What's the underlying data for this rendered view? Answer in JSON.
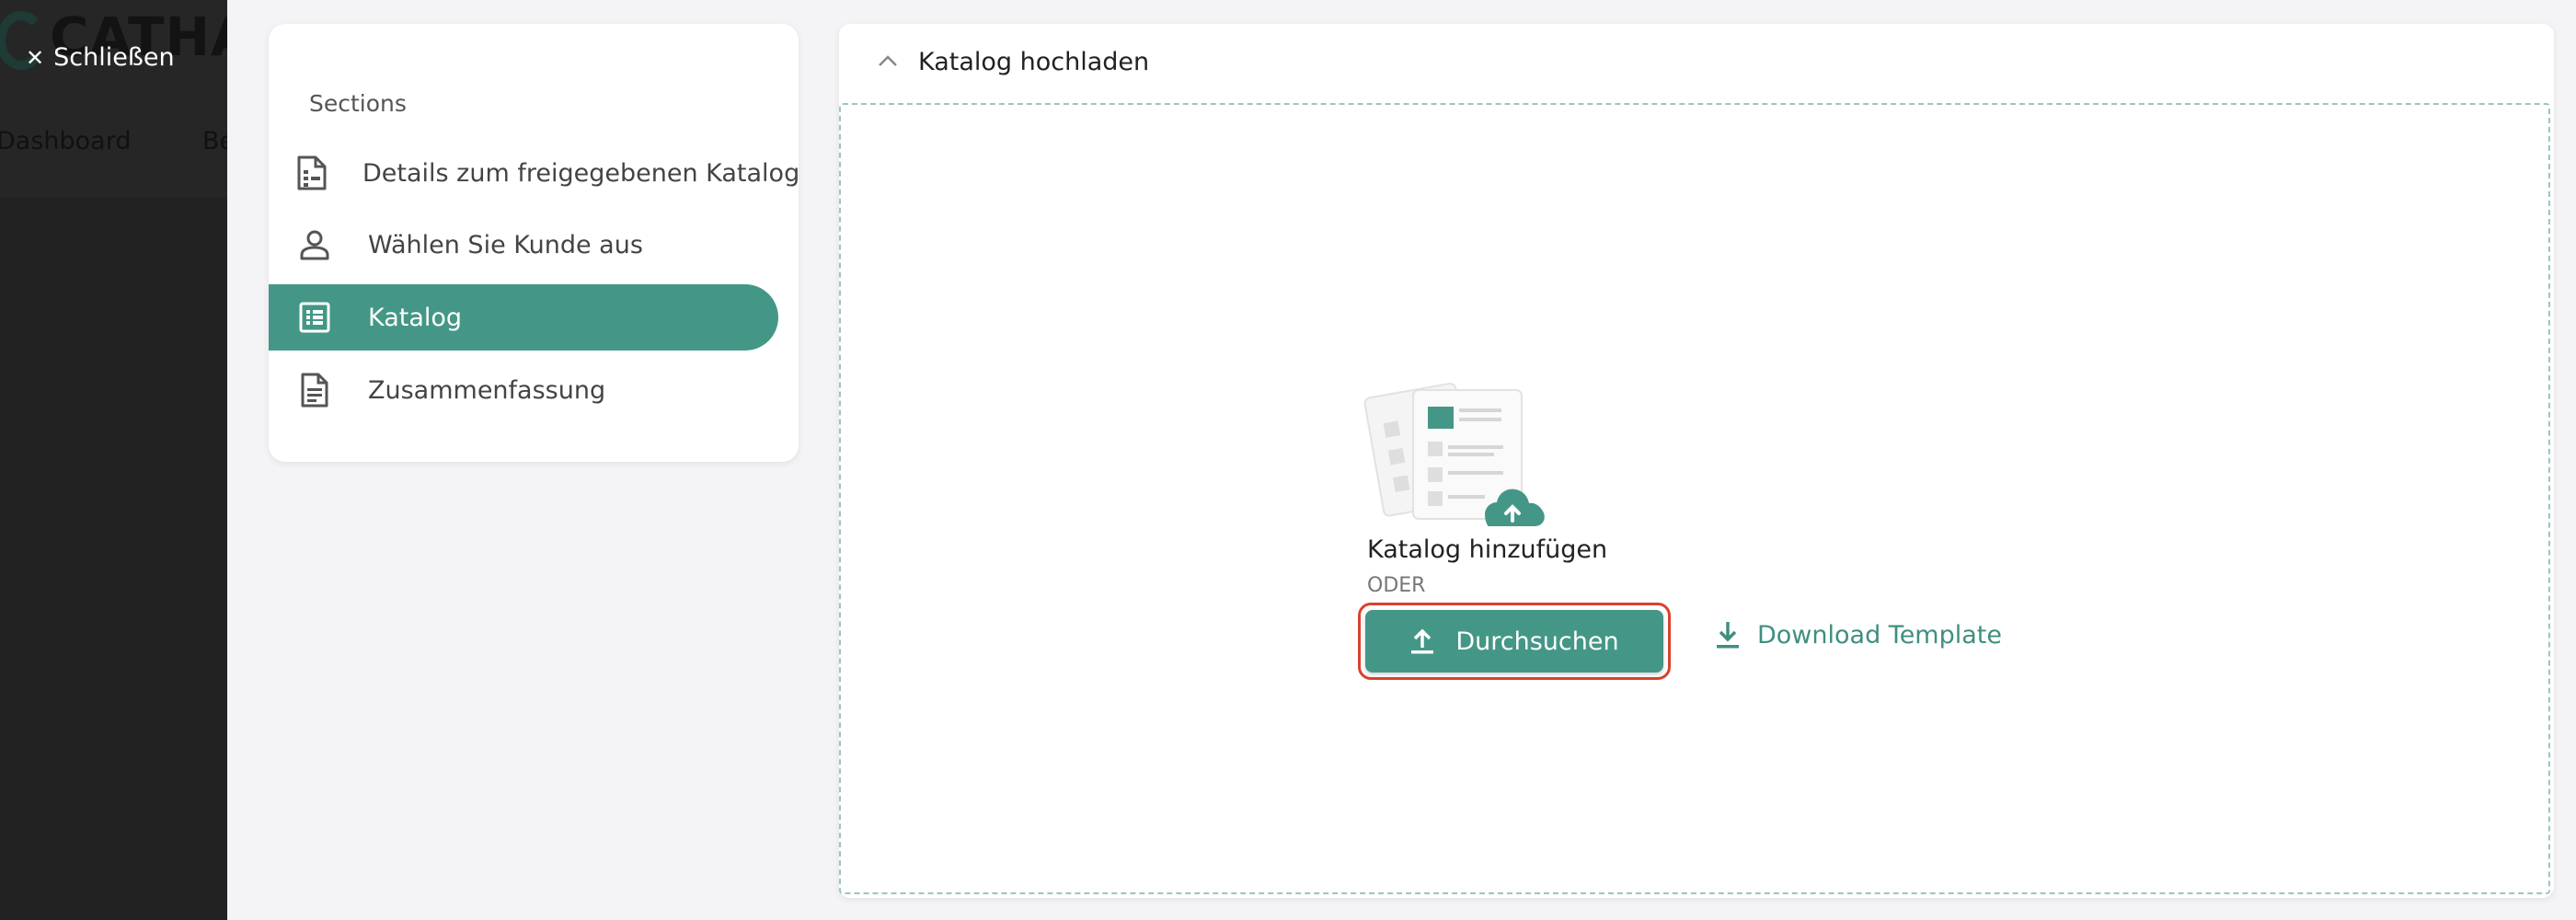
{
  "background_app": {
    "logo_text": "CATHA",
    "close_label": "Schließen",
    "nav": [
      "Dashboard",
      "Be"
    ]
  },
  "sections": {
    "title": "Sections",
    "items": [
      {
        "label": "Details zum freigegebenen Katalog",
        "icon": "document-list-icon",
        "active": false
      },
      {
        "label": "Wählen Sie Kunde aus",
        "icon": "person-icon",
        "active": false
      },
      {
        "label": "Katalog",
        "icon": "list-icon",
        "active": true
      },
      {
        "label": "Zusammenfassung",
        "icon": "document-icon",
        "active": false
      }
    ]
  },
  "upload_panel": {
    "title": "Katalog hochladen",
    "add_text": "Katalog hinzufügen",
    "or_text": "ODER",
    "browse_label": "Durchsuchen",
    "download_label": "Download Template"
  },
  "colors": {
    "accent": "#449786",
    "highlight": "#d9412d",
    "dark": "#222222"
  }
}
